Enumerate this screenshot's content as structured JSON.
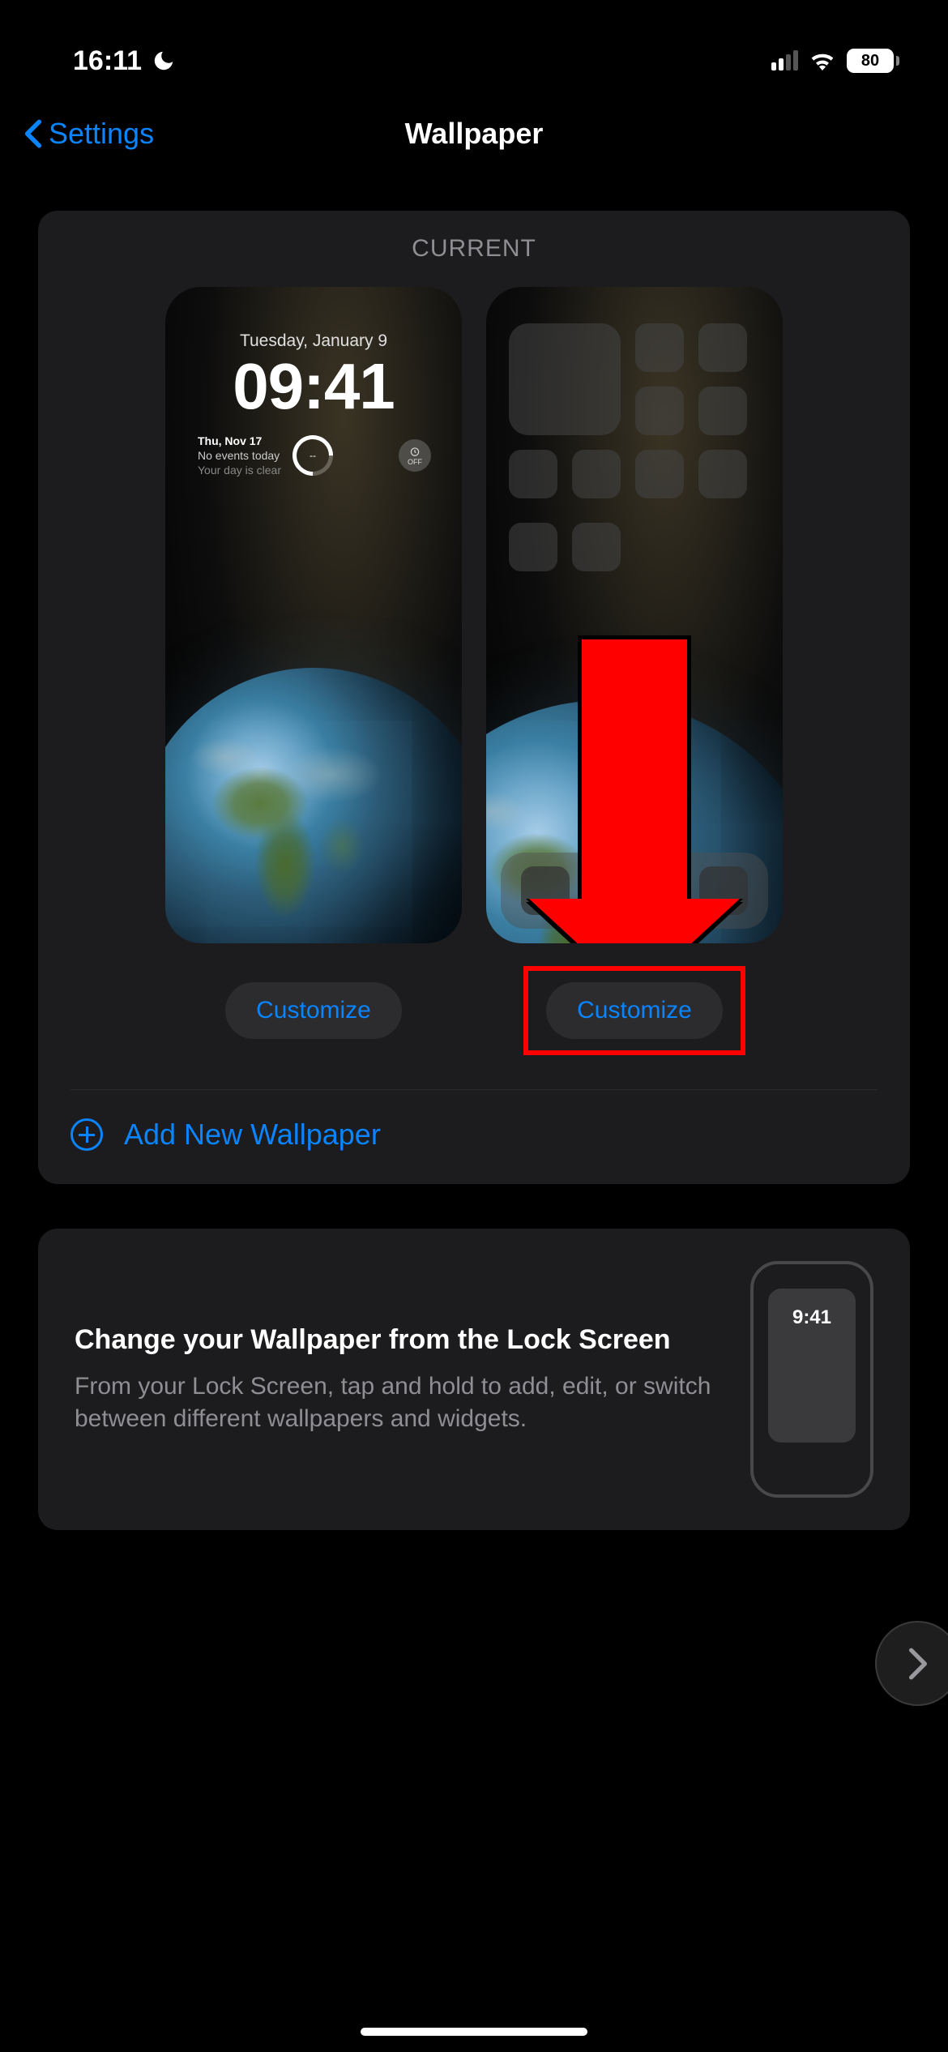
{
  "status": {
    "time": "16:11",
    "battery": "80"
  },
  "nav": {
    "back": "Settings",
    "title": "Wallpaper"
  },
  "current": {
    "header": "CURRENT",
    "lock": {
      "date": "Tuesday, January 9",
      "time": "09:41",
      "widget_line1": "Thu, Nov 17",
      "widget_line2": "No events today",
      "widget_line3": "Your day is clear",
      "alarm_label": "OFF"
    },
    "customize_lock": "Customize",
    "customize_home": "Customize"
  },
  "add": {
    "label": "Add New Wallpaper"
  },
  "info": {
    "title": "Change your Wallpaper from the Lock Screen",
    "desc": "From your Lock Screen, tap and hold to add, edit, or switch between different wallpapers and widgets.",
    "preview_time": "9:41"
  }
}
